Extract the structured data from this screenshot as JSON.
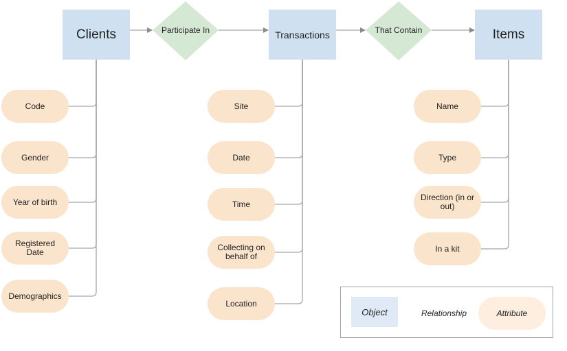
{
  "diagram": {
    "entities": [
      {
        "id": "clients",
        "label": "Clients"
      },
      {
        "id": "transactions",
        "label": "Transactions"
      },
      {
        "id": "items",
        "label": "Items"
      }
    ],
    "relationships": [
      {
        "id": "participate-in",
        "label": "Participate In",
        "from": "clients",
        "to": "transactions"
      },
      {
        "id": "that-contain",
        "label": "That Contain",
        "from": "transactions",
        "to": "items"
      }
    ],
    "attributes": {
      "clients": [
        "Code",
        "Gender",
        "Year of birth",
        "Registered Date",
        "Demographics"
      ],
      "transactions": [
        "Site",
        "Date",
        "Time",
        "Collecting on behalf of",
        "Location"
      ],
      "items": [
        "Name",
        "Type",
        "Direction (in or out)",
        "In a kit"
      ]
    }
  },
  "legend": {
    "object_label": "Object",
    "relationship_label": "Relationship",
    "attribute_label": "Attribute"
  },
  "colors": {
    "entity_fill": "#cfe0f1",
    "relationship_fill": "#d5e8d4",
    "attribute_fill": "#fbe4cc",
    "connector": "#a6a6a6",
    "legend_entity_fill": "#dfeaf6",
    "legend_relationship_fill": "#e3eee2",
    "legend_attribute_fill": "#fdeee0"
  }
}
